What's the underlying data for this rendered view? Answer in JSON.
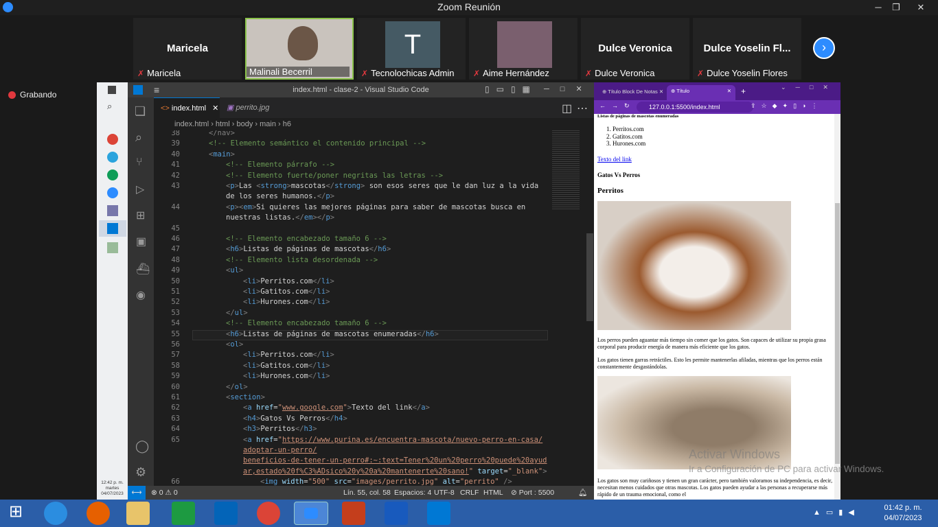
{
  "zoom": {
    "title": "Zoom Reunión",
    "recording": "Grabando",
    "participants": [
      {
        "big": "Maricela",
        "name": "Maricela"
      },
      {
        "big": "",
        "name": "Malinali Becerril"
      },
      {
        "big": "T",
        "name": "Tecnolochicas Admin"
      },
      {
        "big": "",
        "name": "Aime Hernández"
      },
      {
        "big": "Dulce Veronica",
        "name": "Dulce Veronica"
      },
      {
        "big": "Dulce  Yoselin Fl...",
        "name": "Dulce Yoselin Flores"
      }
    ]
  },
  "win8side": {
    "time": "12:42 p. m.",
    "day": "martes",
    "date": "04/07/2023"
  },
  "vscode": {
    "title": "index.html - clase-2 - Visual Studio Code",
    "tabs": [
      "index.html",
      "perrito.jpg"
    ],
    "breadcrumb": [
      "index.html",
      "html",
      "body",
      "main",
      "h6"
    ],
    "status": {
      "problems": "0",
      "warnings": "0",
      "position": "Lín. 55, col. 58",
      "spaces": "Espacios: 4",
      "encoding": "UTF-8",
      "eol": "CRLF",
      "lang": "HTML",
      "port": "Port : 5500"
    },
    "lines": [
      {
        "n": "38",
        "html": "<span class='p'>&lt;/nav&gt;</span>",
        "i": 1
      },
      {
        "n": "39",
        "html": "<span class='c'>&lt;!-- Elemento semántico el contenido principal --&gt;</span>",
        "i": 1
      },
      {
        "n": "40",
        "html": "<span class='p'>&lt;</span><span class='t'>main</span><span class='p'>&gt;</span>",
        "i": 1
      },
      {
        "n": "41",
        "html": "<span class='c'>&lt;!-- Elemento párrafo --&gt;</span>",
        "i": 2
      },
      {
        "n": "42",
        "html": "<span class='c'>&lt;!-- Elemento fuerte/poner negritas las letras --&gt;</span>",
        "i": 2
      },
      {
        "n": "43",
        "html": "<span class='p'>&lt;</span><span class='t'>p</span><span class='p'>&gt;</span>Las <span class='p'>&lt;</span><span class='t'>strong</span><span class='p'>&gt;</span>mascotas<span class='p'>&lt;/</span><span class='t'>strong</span><span class='p'>&gt;</span> son esos seres que le dan luz a la vida",
        "i": 2
      },
      {
        "n": "",
        "html": "de los seres humanos.<span class='p'>&lt;/</span><span class='t'>p</span><span class='p'>&gt;</span>",
        "i": 2
      },
      {
        "n": "44",
        "html": "<span class='p'>&lt;</span><span class='t'>p</span><span class='p'>&gt;&lt;</span><span class='t'>em</span><span class='p'>&gt;</span>Si quieres las mejores páginas para saber de mascotas busca en",
        "i": 2
      },
      {
        "n": "",
        "html": "nuestras listas.<span class='p'>&lt;/</span><span class='t'>em</span><span class='p'>&gt;&lt;/</span><span class='t'>p</span><span class='p'>&gt;</span>",
        "i": 2
      },
      {
        "n": "45",
        "html": "",
        "i": 2
      },
      {
        "n": "46",
        "html": "<span class='c'>&lt;!-- Elemento encabezado tamaño 6 --&gt;</span>",
        "i": 2
      },
      {
        "n": "47",
        "html": "<span class='p'>&lt;</span><span class='t'>h6</span><span class='p'>&gt;</span>Listas de páginas de mascotas<span class='p'>&lt;/</span><span class='t'>h6</span><span class='p'>&gt;</span>",
        "i": 2
      },
      {
        "n": "48",
        "html": "<span class='c'>&lt;!-- Elemento lista desordenada --&gt;</span>",
        "i": 2
      },
      {
        "n": "49",
        "html": "<span class='p'>&lt;</span><span class='t'>ul</span><span class='p'>&gt;</span>",
        "i": 2
      },
      {
        "n": "50",
        "html": "<span class='p'>&lt;</span><span class='t'>li</span><span class='p'>&gt;</span>Perritos.com<span class='p'>&lt;/</span><span class='t'>li</span><span class='p'>&gt;</span>",
        "i": 3
      },
      {
        "n": "51",
        "html": "<span class='p'>&lt;</span><span class='t'>li</span><span class='p'>&gt;</span>Gatitos.com<span class='p'>&lt;/</span><span class='t'>li</span><span class='p'>&gt;</span>",
        "i": 3
      },
      {
        "n": "52",
        "html": "<span class='p'>&lt;</span><span class='t'>li</span><span class='p'>&gt;</span>Hurones.com<span class='p'>&lt;/</span><span class='t'>li</span><span class='p'>&gt;</span>",
        "i": 3
      },
      {
        "n": "53",
        "html": "<span class='p'>&lt;/</span><span class='t'>ul</span><span class='p'>&gt;</span>",
        "i": 2
      },
      {
        "n": "54",
        "html": "<span class='c'>&lt;!-- Elemento encabezado tamaño 6 --&gt;</span>",
        "i": 2
      },
      {
        "n": "55",
        "html": "<span class='p'>&lt;</span><span class='t'>h6</span><span class='p'>&gt;</span>Listas de páginas de mascotas enumeradas<span class='p'>&lt;/</span><span class='t'>h6</span><span class='p'>&gt;</span>",
        "i": 2,
        "cur": 1
      },
      {
        "n": "56",
        "html": "<span class='p'>&lt;</span><span class='t'>ol</span><span class='p'>&gt;</span>",
        "i": 2
      },
      {
        "n": "57",
        "html": "<span class='p'>&lt;</span><span class='t'>li</span><span class='p'>&gt;</span>Perritos.com<span class='p'>&lt;/</span><span class='t'>li</span><span class='p'>&gt;</span>",
        "i": 3
      },
      {
        "n": "58",
        "html": "<span class='p'>&lt;</span><span class='t'>li</span><span class='p'>&gt;</span>Gatitos.com<span class='p'>&lt;/</span><span class='t'>li</span><span class='p'>&gt;</span>",
        "i": 3
      },
      {
        "n": "59",
        "html": "<span class='p'>&lt;</span><span class='t'>li</span><span class='p'>&gt;</span>Hurones.com<span class='p'>&lt;/</span><span class='t'>li</span><span class='p'>&gt;</span>",
        "i": 3
      },
      {
        "n": "60",
        "html": "<span class='p'>&lt;/</span><span class='t'>ol</span><span class='p'>&gt;</span>",
        "i": 2
      },
      {
        "n": "61",
        "html": "<span class='p'>&lt;</span><span class='t'>section</span><span class='p'>&gt;</span>",
        "i": 2
      },
      {
        "n": "62",
        "html": "<span class='p'>&lt;</span><span class='t'>a</span> <span class='a'>href</span>=<span class='s'>\"<u>www.google.com</u>\"</span><span class='p'>&gt;</span>Texto del link<span class='p'>&lt;/</span><span class='t'>a</span><span class='p'>&gt;</span>",
        "i": 3
      },
      {
        "n": "63",
        "html": "<span class='p'>&lt;</span><span class='t'>h4</span><span class='p'>&gt;</span>Gatos Vs Perros<span class='p'>&lt;/</span><span class='t'>h4</span><span class='p'>&gt;</span>",
        "i": 3
      },
      {
        "n": "64",
        "html": "<span class='p'>&lt;</span><span class='t'>h3</span><span class='p'>&gt;</span>Perritos<span class='p'>&lt;/</span><span class='t'>h3</span><span class='p'>&gt;</span>",
        "i": 3
      },
      {
        "n": "65",
        "html": "<span class='p'>&lt;</span><span class='t'>a</span> <span class='a'>href</span>=<span class='s'>\"<u>https://www.purina.es/encuentra-mascota/nuevo-perro-en-casa/</u></span>",
        "i": 3
      },
      {
        "n": "",
        "html": "<span class='s'><u>adoptar-un-perro/</u></span>",
        "i": 3
      },
      {
        "n": "",
        "html": "<span class='s'><u>beneficios-de-tener-un-perro#:~:text=Tener%20un%20perro%20puede%20ayud</u></span>",
        "i": 3
      },
      {
        "n": "",
        "html": "<span class='s'><u>ar,estado%20f%C3%ADsico%20y%20a%20mantenerte%20sano!</u>\"</span> <span class='a'>target</span>=<span class='s'>\"_blank\"</span><span class='p'>&gt;</span>",
        "i": 3
      },
      {
        "n": "66",
        "html": "<span class='p'>&lt;</span><span class='t'>img</span> <span class='a'>width</span>=<span class='s'>\"500\"</span> <span class='a'>src</span>=<span class='s'>\"images/perrito.jpg\"</span> <span class='a'>alt</span>=<span class='s'>\"perrito\"</span> <span class='p'>/&gt;</span>",
        "i": 4
      }
    ]
  },
  "browser": {
    "tabs": [
      "Título Block De Notas",
      "Título"
    ],
    "url": "127.0.0.1:5500/index.html",
    "page": {
      "h6": "Listas de páginas de mascotas enumeradas",
      "ol": [
        "Perritos.com",
        "Gatitos.com",
        "Hurones.com"
      ],
      "link": "Texto del link",
      "h4": "Gatos Vs Perros",
      "h3": "Perritos",
      "p1": "Los perros pueden aguantar más tiempo sin comer que los gatos. Son capaces de utilizar su propia grasa corporal para producir energía de manera más eficiente que los gatos.",
      "p2": "Los gatos tienen garras retráctiles. Esto les permite mantenerlas afiladas, mientras que los perros están constantemente desgastándolas.",
      "p3": "Los gatos son muy cariñosos y tienen un gran carácter, pero también valoramos su independencia, es decir, necesitan menos cuidados que otras mascotas. Los gatos pueden ayudar a las personas a recuperarse más rápido de un trauma emocional, como el",
      "watermark1": "Activar Windows",
      "watermark2": "Ir a Configuración de PC para activar Windows."
    }
  },
  "taskbar": {
    "time": "01:42 p. m.",
    "date": "04/07/2023"
  }
}
